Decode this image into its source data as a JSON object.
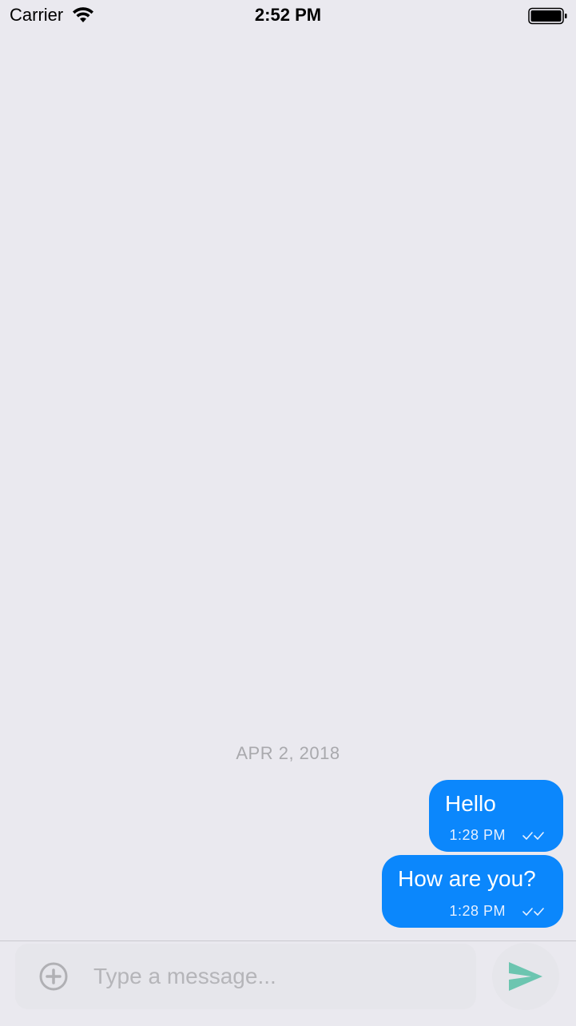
{
  "status_bar": {
    "carrier": "Carrier",
    "time": "2:52 PM",
    "wifi_icon": "wifi-icon",
    "battery_icon": "battery-icon"
  },
  "chat": {
    "date_separator": "APR 2, 2018",
    "messages": [
      {
        "text": "Hello",
        "time": "1:28 PM",
        "status_icon": "double-check-icon",
        "direction": "outgoing"
      },
      {
        "text": "How are you?",
        "time": "1:28 PM",
        "status_icon": "double-check-icon",
        "direction": "outgoing"
      }
    ]
  },
  "composer": {
    "placeholder": "Type a message...",
    "value": "",
    "attach_icon": "plus-circle-icon",
    "send_icon": "send-icon"
  },
  "colors": {
    "background": "#EAE9EF",
    "bubble": "#0B87FC",
    "bubble_text": "#FFFFFF",
    "date_text": "#A9A9AD",
    "placeholder": "#B5B5B9",
    "send_accent": "#6CC5B0"
  }
}
